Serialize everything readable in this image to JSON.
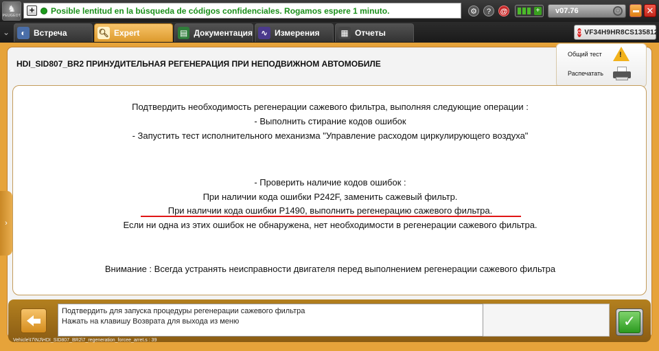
{
  "header": {
    "logo_text": "PEUGEOT",
    "status_message": "Posible lentitud en la búsqueda de códigos confidenciales. Rogamos espere 1 minuto.",
    "expand_symbol": "+",
    "version": "v07.76"
  },
  "tabs": [
    {
      "label": "Встреча",
      "active": false,
      "icon": "meeting-icon"
    },
    {
      "label": "Expert",
      "active": true,
      "icon": "magnifier-icon"
    },
    {
      "label": "Документация",
      "active": false,
      "icon": "book-icon"
    },
    {
      "label": "Измерения",
      "active": false,
      "icon": "waveform-icon"
    },
    {
      "label": "Отчеты",
      "active": false,
      "icon": "report-icon"
    }
  ],
  "vin": "VF34H9HR8CS135812",
  "page": {
    "title": "HDI_SID807_BR2  ПРИНУДИТЕЛЬНАЯ РЕГЕНЕРАЦИЯ ПРИ НЕПОДВИЖНОМ АВТОМОБИЛЕ"
  },
  "side_actions": {
    "global_test": "Общий тест",
    "print": "Распечатать"
  },
  "content": {
    "lines": [
      "Подтвердить необходимость регенерации сажевого фильтра, выполняя следующие операции :",
      "- Выполнить стирание кодов ошибок",
      "- Запустить тест исполнительного механизма \"Управление расходом циркулирующего воздуха\"",
      "- Проверить наличие кодов ошибок :",
      "При наличии кода ошибки P242F, заменить сажевый фильтр.",
      "При наличии кода ошибки P1490, выполнить регенерацию сажевого фильтра.",
      "Если ни одна из этих ошибок не обнаружена, нет необходимости в регенерации сажевого фильтра.",
      "Внимание : Всегда устранять неисправности двигателя перед выполнением регенерации сажевого фильтра"
    ],
    "highlight_color": "#e01515"
  },
  "footer": {
    "message_line1": "Подтвердить для запуска процедуры регенерации сажевого фильтра",
    "message_line2": "Нажать на клавишу Возврата для выхода из меню",
    "path": "Vehicle\\I7\\NJ\\HDI_SID807_BR2\\7_regeneration_forcee_arret.s : 39"
  },
  "colors": {
    "accent_orange": "#e6a33a",
    "status_green": "#1a8f1a",
    "confirm_green": "#2b9a1f"
  }
}
